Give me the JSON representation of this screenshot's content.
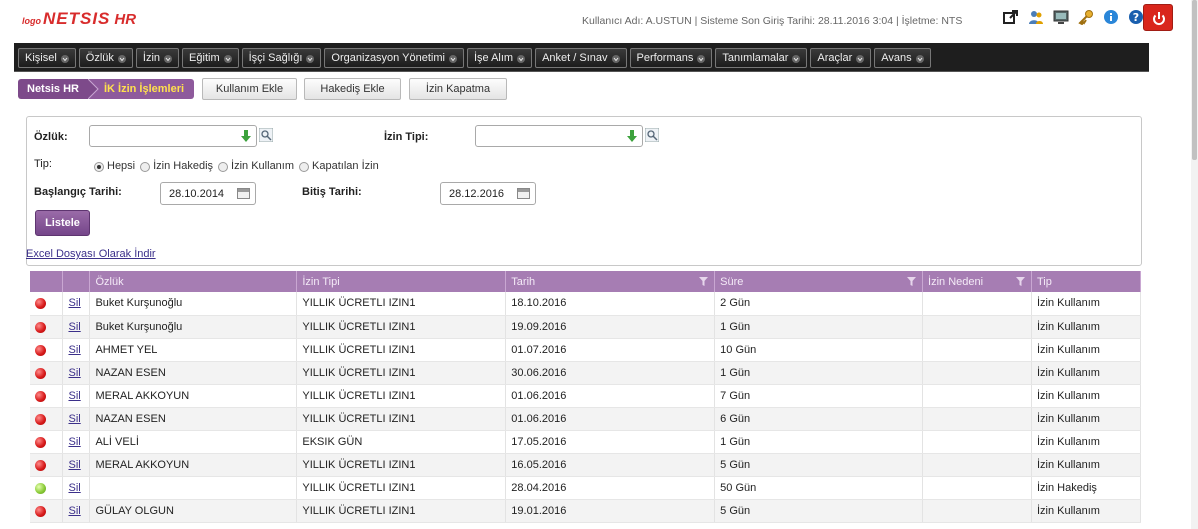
{
  "brand": {
    "prefix": "logo",
    "name": "NETSIS",
    "suffix": "HR"
  },
  "header": {
    "user_info": "Kullanıcı Adı: A.USTUN | Sisteme Son Giriş Tarihi: 28.11.2016 3:04 | İşletme: NTS"
  },
  "toolbar_icons": [
    "external-link-icon",
    "users-icon",
    "monitor-icon",
    "key-icon",
    "info-icon",
    "help-icon"
  ],
  "menu": [
    {
      "label": "Kişisel"
    },
    {
      "label": "Özlük"
    },
    {
      "label": "İzin"
    },
    {
      "label": "Eğitim"
    },
    {
      "label": "İşçi Sağlığı"
    },
    {
      "label": "Organizasyon Yönetimi"
    },
    {
      "label": "İşe Alım"
    },
    {
      "label": "Anket / Sınav"
    },
    {
      "label": "Performans"
    },
    {
      "label": "Tanımlamalar"
    },
    {
      "label": "Araçlar"
    },
    {
      "label": "Avans"
    }
  ],
  "breadcrumb": {
    "root": "Netsis HR",
    "current": "İK İzin İşlemleri"
  },
  "tabs": {
    "kullanim": "Kullanım Ekle",
    "hakedis": "Hakediş Ekle",
    "kapatma": "İzin Kapatma"
  },
  "filters": {
    "ozluk_label": "Özlük:",
    "ozluk_value": "",
    "izin_tipi_label": "İzin Tipi:",
    "izin_tipi_value": "",
    "tip_label": "Tip:",
    "tip_options": [
      "Hepsi",
      "İzin Hakediş",
      "İzin Kullanım",
      "Kapatılan İzin"
    ],
    "tip_selected": "Hepsi",
    "baslangic_label": "Başlangıç Tarihi:",
    "baslangic_value": "28.10.2014",
    "bitis_label": "Bitiş Tarihi:",
    "bitis_value": "28.12.2016",
    "listele": "Listele",
    "excel": "Excel Dosyası Olarak İndir"
  },
  "grid": {
    "columns": [
      "Özlük",
      "İzin Tipi",
      "Tarih",
      "Süre",
      "İzin Nedeni",
      "Tip"
    ],
    "delete_label": "Sil",
    "rows": [
      {
        "status": "red",
        "ozluk": "Buket Kurşunoğlu",
        "izin_tipi": "YILLIK ÜCRETLI IZIN1",
        "tarih": "18.10.2016",
        "sure": "2 Gün",
        "neden": "",
        "tip": "İzin Kullanım"
      },
      {
        "status": "red",
        "ozluk": "Buket Kurşunoğlu",
        "izin_tipi": "YILLIK ÜCRETLI IZIN1",
        "tarih": "19.09.2016",
        "sure": "1 Gün",
        "neden": "",
        "tip": "İzin Kullanım"
      },
      {
        "status": "red",
        "ozluk": "AHMET YEL",
        "izin_tipi": "YILLIK ÜCRETLI IZIN1",
        "tarih": "01.07.2016",
        "sure": "10 Gün",
        "neden": "",
        "tip": "İzin Kullanım"
      },
      {
        "status": "red",
        "ozluk": "NAZAN ESEN",
        "izin_tipi": "YILLIK ÜCRETLI IZIN1",
        "tarih": "30.06.2016",
        "sure": "1 Gün",
        "neden": "",
        "tip": "İzin Kullanım"
      },
      {
        "status": "red",
        "ozluk": "MERAL AKKOYUN",
        "izin_tipi": "YILLIK ÜCRETLI IZIN1",
        "tarih": "01.06.2016",
        "sure": "7 Gün",
        "neden": "",
        "tip": "İzin Kullanım"
      },
      {
        "status": "red",
        "ozluk": "NAZAN ESEN",
        "izin_tipi": "YILLIK ÜCRETLI IZIN1",
        "tarih": "01.06.2016",
        "sure": "6 Gün",
        "neden": "",
        "tip": "İzin Kullanım"
      },
      {
        "status": "red",
        "ozluk": "ALİ VELİ",
        "izin_tipi": "EKSIK GÜN",
        "tarih": "17.05.2016",
        "sure": "1 Gün",
        "neden": "",
        "tip": "İzin Kullanım"
      },
      {
        "status": "red",
        "ozluk": "MERAL AKKOYUN",
        "izin_tipi": "YILLIK ÜCRETLI IZIN1",
        "tarih": "16.05.2016",
        "sure": "5 Gün",
        "neden": "",
        "tip": "İzin Kullanım"
      },
      {
        "status": "green",
        "ozluk": "",
        "izin_tipi": "YILLIK ÜCRETLI IZIN1",
        "tarih": "28.04.2016",
        "sure": "50 Gün",
        "neden": "",
        "tip": "İzin Hakediş"
      },
      {
        "status": "red",
        "ozluk": "GÜLAY OLGUN",
        "izin_tipi": "YILLIK ÜCRETLI IZIN1",
        "tarih": "19.01.2016",
        "sure": "5 Gün",
        "neden": "",
        "tip": "İzin Kullanım"
      }
    ]
  },
  "colors": {
    "accent": "#a67db3",
    "breadcrumb": "#7d4a8a",
    "menubar": "#1e1e1e",
    "logo": "#d82c2c"
  }
}
